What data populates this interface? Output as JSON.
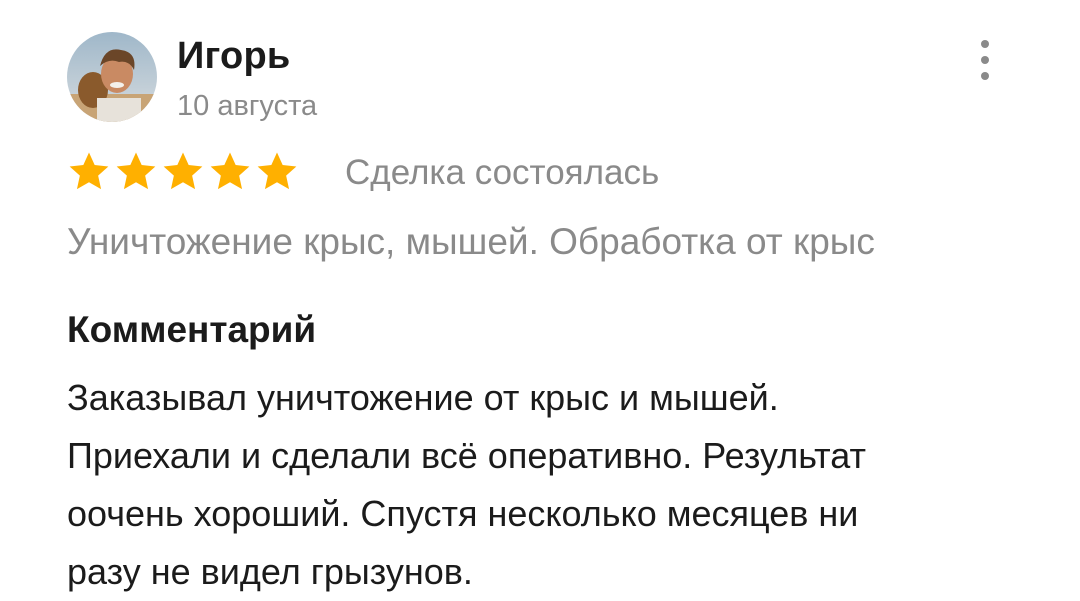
{
  "review": {
    "author": {
      "name": "Игорь",
      "date": "10 августа",
      "avatar": "user-photo"
    },
    "menu_icon": "more-vertical-icon",
    "rating": {
      "value": 5,
      "max": 5,
      "star_color": "#FFB000",
      "icon": "star-icon"
    },
    "deal_status": "Сделка состоялась",
    "service": "Уничтожение крыс, мышей. Обработка от крыс",
    "comment": {
      "heading": "Комментарий",
      "lines": [
        "Заказывал уничтожение от крыс и мышей.",
        "Приехали и сделали всё оперативно. Результат",
        "оочень хороший. Спустя несколько месяцев ни",
        "разу не видел грызунов."
      ]
    }
  }
}
